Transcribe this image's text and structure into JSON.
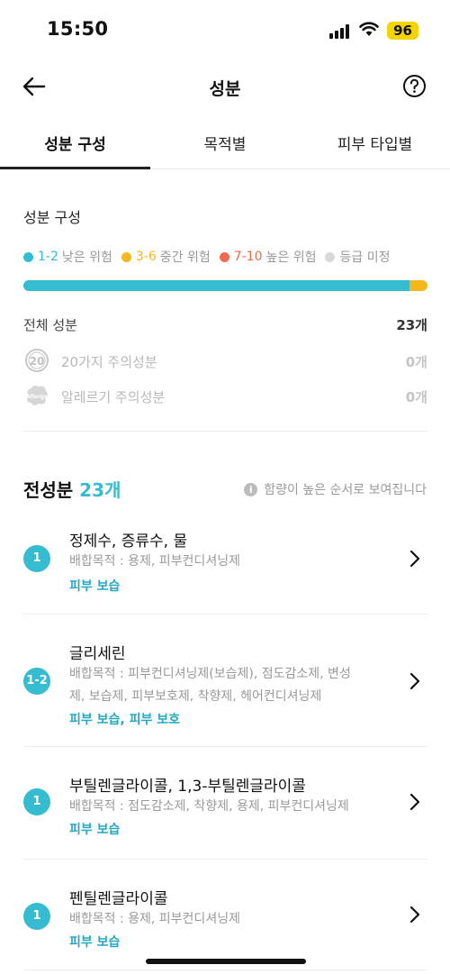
{
  "status": {
    "time": "15:50",
    "battery": "96"
  },
  "header": {
    "title": "성분"
  },
  "tabs": [
    {
      "label": "성분 구성",
      "active": true
    },
    {
      "label": "목적별",
      "active": false
    },
    {
      "label": "피부 타입별",
      "active": false
    }
  ],
  "composition": {
    "label": "성분 구성",
    "legend": [
      {
        "range": "1-2",
        "desc": "낮은 위험",
        "color": "#35bcd0"
      },
      {
        "range": "3-6",
        "desc": "중간 위험",
        "color": "#f5b81c"
      },
      {
        "range": "7-10",
        "desc": "높은 위험",
        "color": "#f26a4f"
      },
      {
        "range": "",
        "desc": "등급 미정",
        "color": "#d8d8d8"
      }
    ],
    "bar_fraction": {
      "low": 0.956,
      "mid": 0.044,
      "high": 0,
      "unrated": 0
    },
    "total": {
      "label": "전체 성분",
      "value": "23개"
    },
    "caution20": {
      "label": "20가지 주의성분",
      "value": "0개",
      "icon_text": "20"
    },
    "allergy": {
      "label": "알레르기 주의성분",
      "value": "0개",
      "icon_text": "Allergy"
    }
  },
  "all_ingredients": {
    "title": "전성분",
    "count": "23개",
    "note": "함량이 높은 순서로 보여집니다",
    "items": [
      {
        "grade": "1",
        "name": "정제수, 증류수, 물",
        "purpose": "배합목적 : 용제, 피부컨디셔닝제",
        "tags": "피부 보습"
      },
      {
        "grade": "1-2",
        "name": "글리세린",
        "purpose": "배합목적 : 피부컨디셔닝제(보습제), 점도감소제, 변성제, 보습제, 피부보호제, 착향제, 헤어컨디셔닝제",
        "tags": "피부 보습, 피부 보호"
      },
      {
        "grade": "1",
        "name": "부틸렌글라이콜, 1,3-부틸렌글라이콜",
        "purpose": "배합목적 : 점도감소제, 착향제, 용제, 피부컨디셔닝제",
        "tags": "피부 보습"
      },
      {
        "grade": "1",
        "name": "펜틸렌글라이콜",
        "purpose": "배합목적 : 용제, 피부컨디셔닝제",
        "tags": "피부 보습"
      }
    ]
  }
}
